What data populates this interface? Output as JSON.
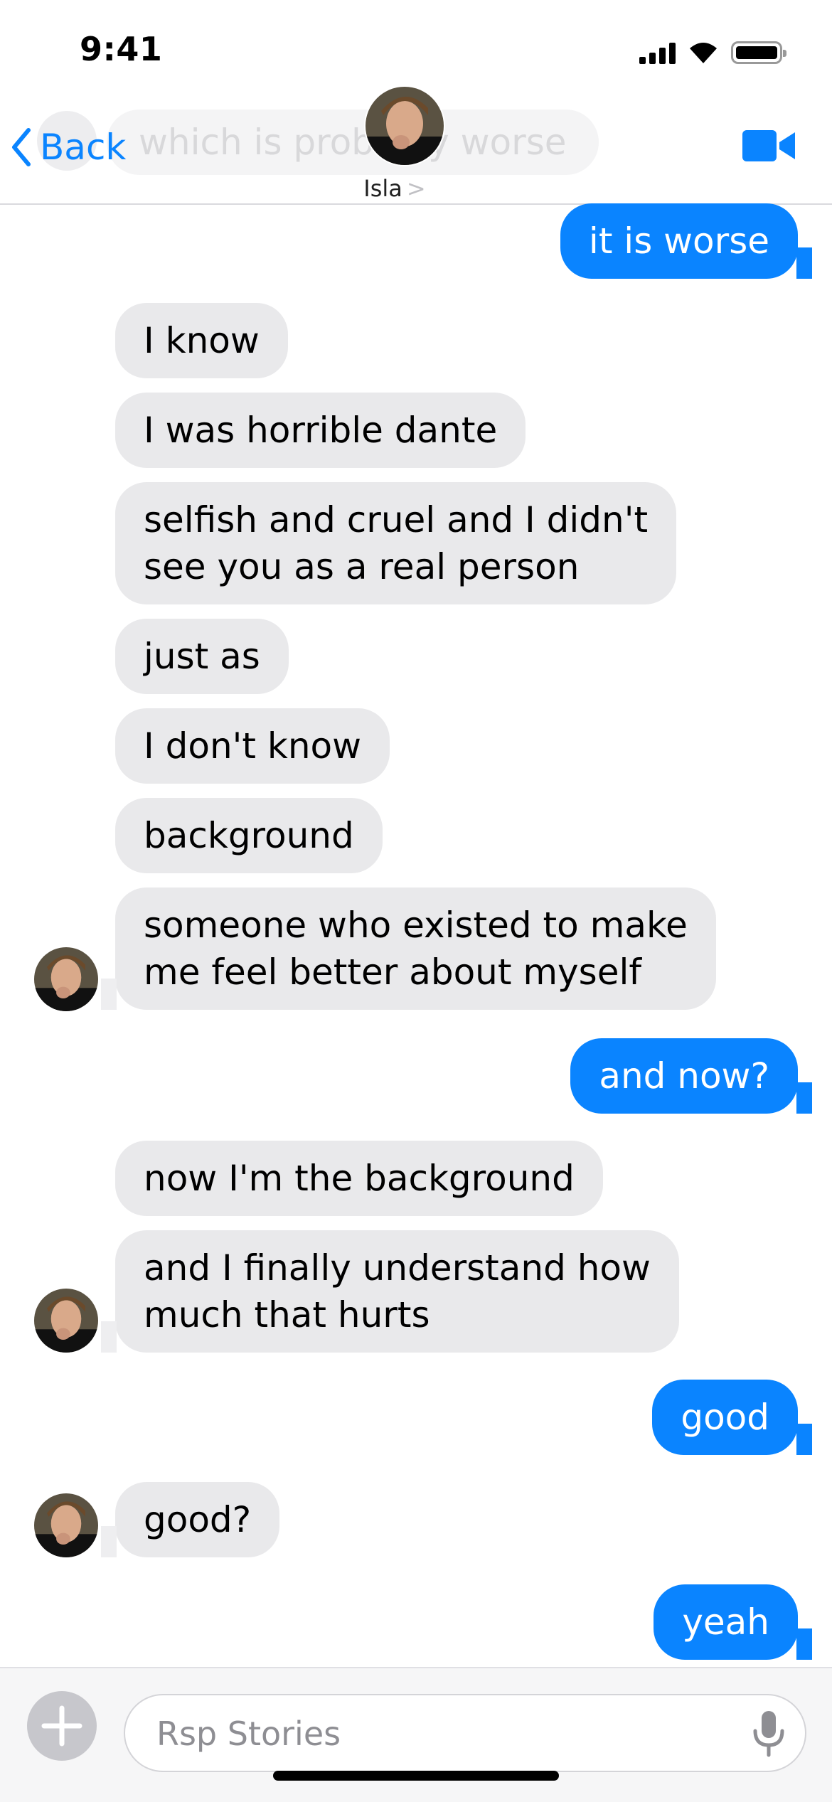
{
  "status_bar": {
    "time": "9:41"
  },
  "header": {
    "back_label": "Back",
    "ghost_text": "which is probably worse",
    "contact_name": "Isla",
    "chevron": ">"
  },
  "messages": [
    {
      "dir": "out",
      "text": "it is worse"
    },
    {
      "dir": "in",
      "text": "I know"
    },
    {
      "dir": "in",
      "text": "I was horrible dante"
    },
    {
      "dir": "in",
      "text": "selfish and cruel and I didn't\nsee you as a real person"
    },
    {
      "dir": "in",
      "text": "just as"
    },
    {
      "dir": "in",
      "text": "I don't know"
    },
    {
      "dir": "in",
      "text": "background"
    },
    {
      "dir": "in",
      "text": "someone who existed to make\nme feel better about myself"
    },
    {
      "dir": "out",
      "text": "and now?"
    },
    {
      "dir": "in",
      "text": "now I'm the background"
    },
    {
      "dir": "in",
      "text": "and I finally understand how\nmuch that hurts"
    },
    {
      "dir": "out",
      "text": "good"
    },
    {
      "dir": "in",
      "text": "good?"
    },
    {
      "dir": "out",
      "text": "yeah"
    }
  ],
  "input": {
    "placeholder": "Rsp Stories"
  },
  "icons": {
    "back": "chevron-left-icon",
    "video": "video-camera-icon",
    "plus": "plus-icon",
    "mic": "microphone-icon"
  },
  "colors": {
    "accent": "#0a84ff",
    "incoming_bubble": "#e9e9eb",
    "outgoing_bubble": "#0a84ff"
  }
}
